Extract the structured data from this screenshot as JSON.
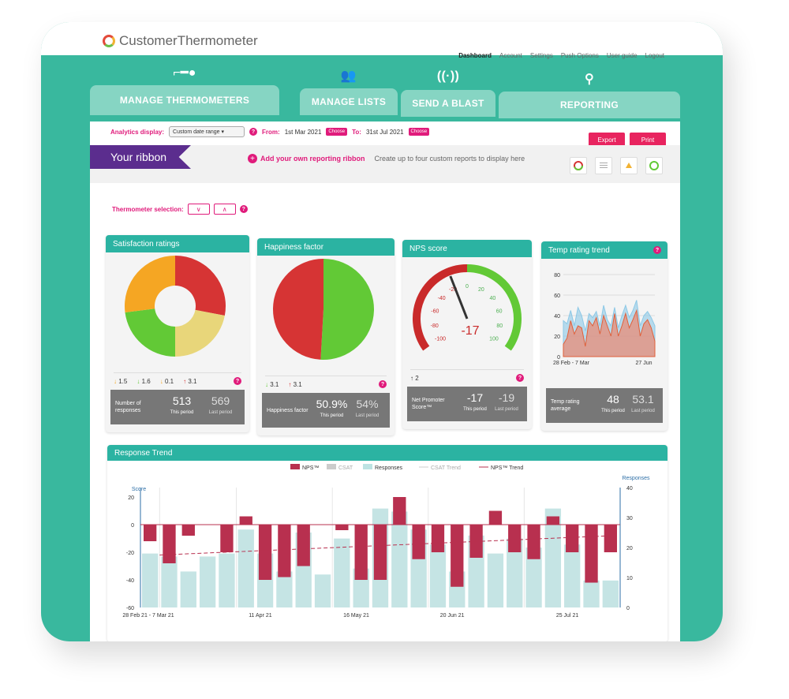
{
  "app": {
    "logo": "CustomerThermometer"
  },
  "nav": [
    "Dashboard",
    "Account",
    "Settings",
    "Push Options",
    "User guide",
    "Logout"
  ],
  "tabs": [
    "MANAGE THERMOMETERS",
    "MANAGE LISTS",
    "SEND A BLAST",
    "REPORTING"
  ],
  "toolbar": {
    "analytics_label": "Analytics display:",
    "range_value": "Custom date range",
    "from_label": "From:",
    "from_date": "1st Mar 2021",
    "to_label": "To:",
    "to_date": "31st Jul 2021",
    "choose": "Choose",
    "export": "Export",
    "print": "Print"
  },
  "ribbon": {
    "title": "Your ribbon",
    "add": "Add your own reporting ribbon",
    "desc": "Create up to four custom reports to display here"
  },
  "thermometer_selection": "Thermometer selection:",
  "cards": {
    "satisfaction": {
      "title": "Satisfaction ratings",
      "arrows": [
        "1.5",
        "1.6",
        "0.1",
        "3.1"
      ],
      "label": "Number of responses",
      "this": "513",
      "last": "569",
      "this_lbl": "This period",
      "last_lbl": "Last period"
    },
    "happiness": {
      "title": "Happiness factor",
      "arrows": [
        "3.1",
        "3.1"
      ],
      "label": "Happiness factor",
      "this": "50.9%",
      "last": "54%",
      "this_lbl": "This period",
      "last_lbl": "Last period"
    },
    "nps": {
      "title": "NPS score",
      "arrows": [
        "2"
      ],
      "label": "Net Promoter Score™",
      "this": "-17",
      "last": "-19",
      "this_lbl": "This period",
      "last_lbl": "Last period",
      "gauge_value": "-17",
      "ticks": [
        "-100",
        "-80",
        "-60",
        "-40",
        "-20",
        "0",
        "20",
        "40",
        "60",
        "80",
        "100"
      ]
    },
    "temp": {
      "title": "Temp rating trend",
      "label": "Temp rating average",
      "this": "48",
      "last": "53.1",
      "this_lbl": "This period",
      "last_lbl": "Last period",
      "yticks": [
        "80",
        "60",
        "40",
        "20",
        "0"
      ],
      "xticks": [
        "28 Feb - 7 Mar",
        "27 Jun"
      ]
    }
  },
  "chart_data": [
    {
      "type": "pie",
      "title": "Satisfaction ratings",
      "values": [
        28,
        22,
        23,
        27
      ],
      "colors": [
        "#d63434",
        "#e8d67a",
        "#62c936",
        "#f5a623"
      ]
    },
    {
      "type": "pie",
      "title": "Happiness factor",
      "values": [
        50.9,
        49.1
      ],
      "colors": [
        "#62c936",
        "#d63434"
      ]
    },
    {
      "type": "bar",
      "title": "Response Trend",
      "legend": [
        "NPS™",
        "CSAT",
        "Responses",
        "CSAT Trend",
        "NPS™ Trend"
      ],
      "ylabel": "Score",
      "y2label": "Responses",
      "yticks": [
        "20",
        "0",
        "-20",
        "-40",
        "-60"
      ],
      "y2ticks": [
        "40",
        "30",
        "20",
        "10",
        "0"
      ],
      "xticks": [
        "28 Feb 21 - 7 Mar 21",
        "11 Apr 21",
        "16 May 21",
        "20 Jun 21",
        "25 Jul 21"
      ],
      "ylim": [
        -60,
        20
      ],
      "y2lim": [
        0,
        40
      ],
      "nps": [
        -12,
        -28,
        -8,
        0,
        -20,
        6,
        -40,
        -38,
        -30,
        0,
        -4,
        -40,
        -40,
        20,
        -25,
        -20,
        -45,
        -24,
        10,
        -20,
        -25,
        6,
        -20,
        -42,
        -20
      ],
      "responses": [
        18,
        17,
        12,
        17,
        18,
        26,
        18,
        12,
        25,
        11,
        23,
        13,
        33,
        32,
        26,
        21,
        12,
        24,
        18,
        23,
        20,
        33,
        21,
        9,
        9
      ]
    }
  ],
  "temp_chart": {
    "blue": [
      35,
      32,
      45,
      30,
      48,
      40,
      25,
      42,
      38,
      44,
      30,
      50,
      36,
      30,
      48,
      28,
      40,
      50,
      38,
      45,
      55,
      30,
      40,
      44,
      38,
      30
    ],
    "red": [
      12,
      18,
      35,
      22,
      30,
      28,
      10,
      35,
      30,
      38,
      22,
      40,
      30,
      20,
      42,
      20,
      30,
      42,
      28,
      36,
      45,
      20,
      32,
      36,
      28,
      15
    ]
  },
  "response_trend_title": "Response Trend"
}
